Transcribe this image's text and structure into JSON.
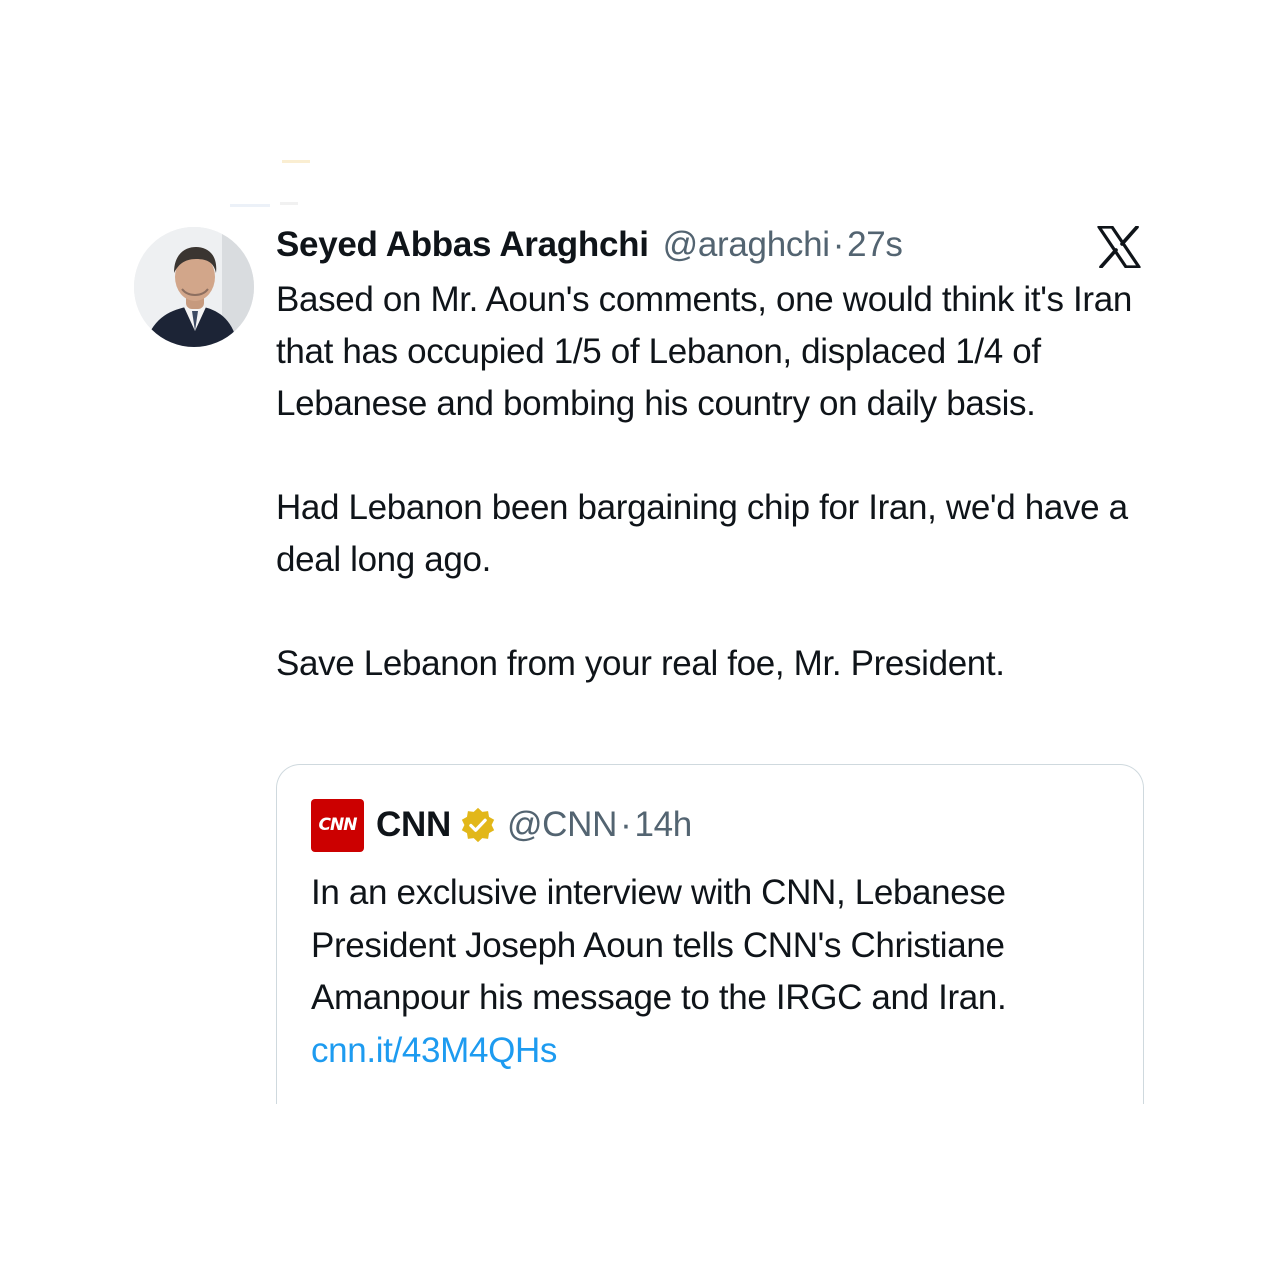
{
  "tweet": {
    "author": {
      "display_name": "Seyed Abbas Araghchi",
      "handle": "@araghchi",
      "avatar_icon": "profile-photo"
    },
    "separator": "·",
    "time": "27s",
    "platform_icon": "x-logo-icon",
    "paragraphs": [
      "Based on Mr. Aoun's comments, one would think it's Iran that has occupied 1/5 of Lebanon, displaced 1/4 of Lebanese and bombing his country on daily basis.",
      "Had Lebanon been bargaining chip for Iran, we'd have a deal long ago.",
      "Save Lebanon from your real foe, Mr. President."
    ]
  },
  "quoted_tweet": {
    "logo_text": "CNN",
    "display_name": "CNN",
    "verified_icon": "gold-verified-badge-icon",
    "handle": "@CNN",
    "separator": "·",
    "time": "14h",
    "text": "In an exclusive interview with CNN, Lebanese President Joseph Aoun tells CNN's Christiane Amanpour his message to the IRGC and Iran.",
    "link": "cnn.it/43M4QHs"
  },
  "colors": {
    "text_primary": "#0f1419",
    "text_secondary": "#536471",
    "link": "#1d9bf0",
    "border": "#cfd9de",
    "cnn_red": "#cc0000",
    "verified_gold": "#e2b719"
  }
}
